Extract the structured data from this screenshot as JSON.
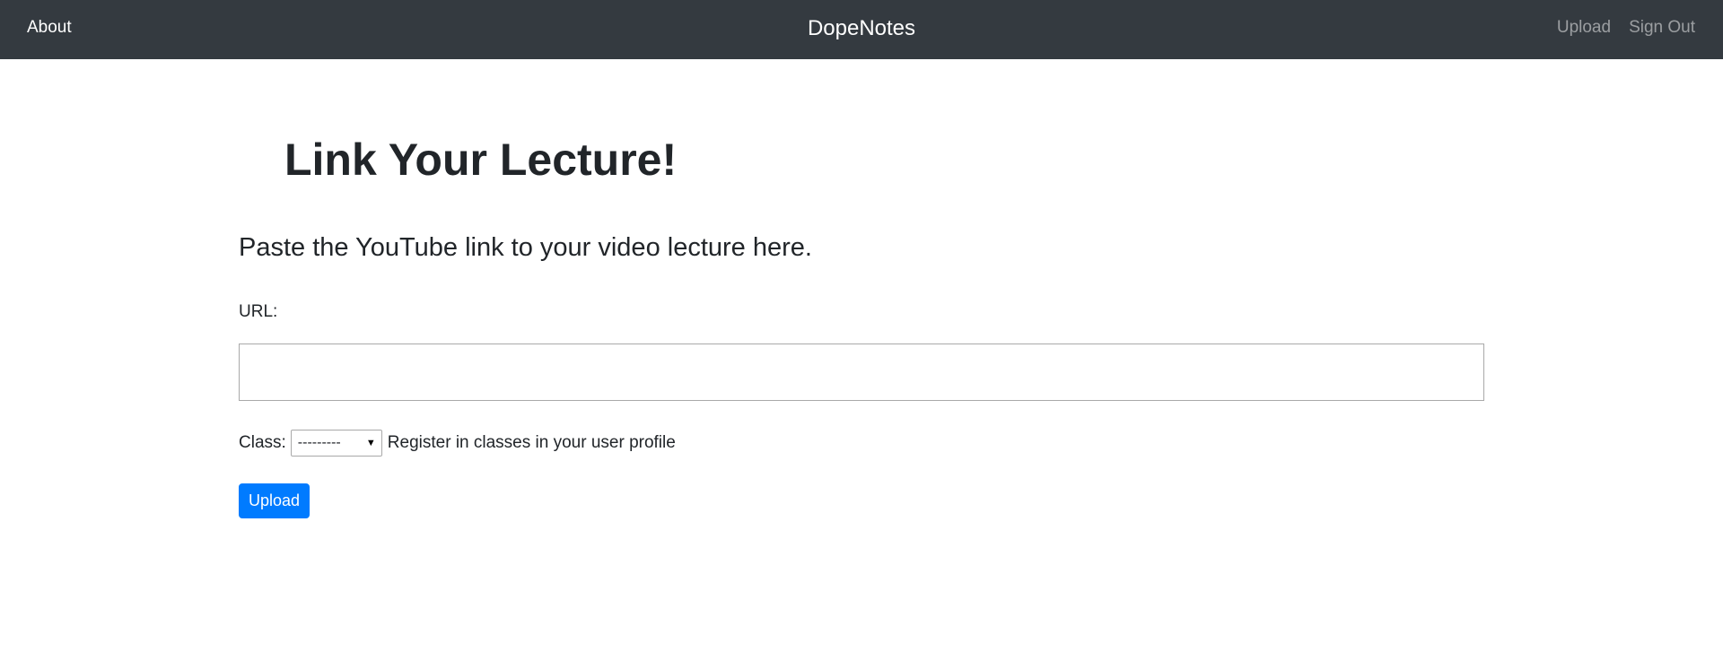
{
  "navbar": {
    "about_label": "About",
    "brand": "DopeNotes",
    "upload_label": "Upload",
    "signout_label": "Sign Out"
  },
  "main": {
    "title": "Link Your Lecture!",
    "subtitle": "Paste the YouTube link to your video lecture here.",
    "url_label": "URL:",
    "url_value": "",
    "class_label": "Class:",
    "class_selected": "---------",
    "class_hint": "Register in classes in your user profile",
    "upload_button": "Upload"
  },
  "colors": {
    "navbar_bg": "#343a40",
    "primary": "#007bff",
    "text": "#212529"
  }
}
